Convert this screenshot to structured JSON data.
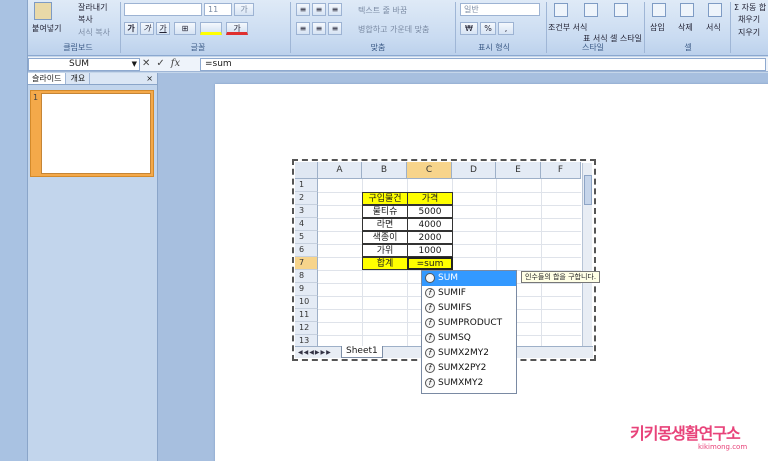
{
  "ribbon": {
    "clipboard": {
      "paste": "붙여넣기",
      "cut": "잘라내기",
      "copy": "복사",
      "format_painter": "서식 복사",
      "group": "클립보드"
    },
    "font": {
      "size": "11",
      "bold": "가",
      "italic": "가",
      "underline": "가",
      "group": "글꼴"
    },
    "alignment": {
      "wrap": "텍스트 줄 바꿈",
      "merge": "병합하고 가운데 맞춤",
      "group": "맞춤"
    },
    "number": {
      "format": "일반",
      "currency": "₩",
      "percent": "%",
      "group": "표시 형식"
    },
    "styles": {
      "conditional": "조건부 서식",
      "table": "표 서식",
      "cell": "셀 스타일",
      "group": "스타일"
    },
    "cells": {
      "insert": "삽입",
      "delete": "삭제",
      "format": "서식",
      "group": "셀"
    },
    "editing": {
      "autosum": "자동 합",
      "fill": "채우기",
      "clear": "지우기"
    }
  },
  "formula_bar": {
    "name_box": "SUM",
    "formula": "=sum",
    "cancel": "✕",
    "enter": "✓",
    "fx": "fx"
  },
  "pane": {
    "tab_slides": "슬라이드",
    "tab_outline": "개요",
    "close": "×",
    "slide_number": "1"
  },
  "sheet": {
    "columns": [
      "A",
      "B",
      "C",
      "D",
      "E",
      "F"
    ],
    "rows": [
      "1",
      "2",
      "3",
      "4",
      "5",
      "6",
      "7",
      "8",
      "9",
      "10",
      "11",
      "12",
      "13"
    ],
    "header_item": "구입물건",
    "header_price": "가격",
    "items": [
      {
        "name": "물티슈",
        "price": "5000"
      },
      {
        "name": "라면",
        "price": "4000"
      },
      {
        "name": "색종이",
        "price": "2000"
      },
      {
        "name": "가위",
        "price": "1000"
      }
    ],
    "total_label": "합계",
    "total_formula": "=sum",
    "tab_name": "Sheet1"
  },
  "autocomplete": {
    "items": [
      "SUM",
      "SUMIF",
      "SUMIFS",
      "SUMPRODUCT",
      "SUMSQ",
      "SUMX2MY2",
      "SUMX2PY2",
      "SUMXMY2"
    ],
    "selected_index": 0,
    "tooltip": "인수들의 합을 구합니다."
  },
  "watermark": {
    "title": "키키몽생활연구소",
    "url": "kikimong.com"
  },
  "colors": {
    "highlight": "#ffff00",
    "selection": "#3399ff",
    "watermark": "#e8437a"
  }
}
